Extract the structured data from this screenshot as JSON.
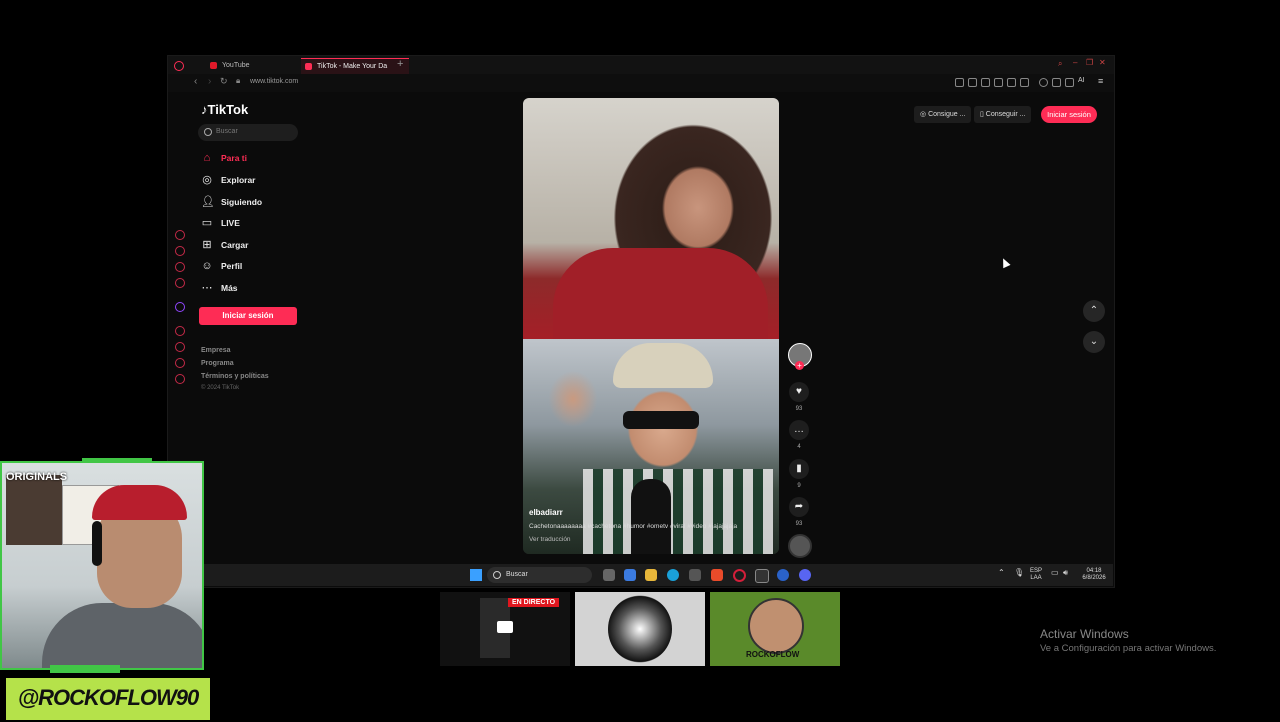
{
  "browser": {
    "tabs": [
      {
        "label": "YouTube"
      },
      {
        "label": "TikTok - Make Your Da"
      }
    ],
    "url": "www.tiktok.com"
  },
  "tiktok": {
    "logo": "TikTok",
    "search_placeholder": "Buscar",
    "nav": [
      {
        "label": "Para ti",
        "icon": "home-icon"
      },
      {
        "label": "Explorar",
        "icon": "compass-icon"
      },
      {
        "label": "Siguiendo",
        "icon": "following-icon"
      },
      {
        "label": "LIVE",
        "icon": "live-icon"
      },
      {
        "label": "Cargar",
        "icon": "upload-icon"
      },
      {
        "label": "Perfil",
        "icon": "profile-icon"
      },
      {
        "label": "Más",
        "icon": "more-icon"
      }
    ],
    "login_side": "Iniciar sesión",
    "footer": [
      "Empresa",
      "Programa",
      "Términos y políticas",
      "© 2024 TikTok"
    ],
    "top_buttons": [
      "Consigue ...",
      "Conseguir ...",
      "Iniciar sesión"
    ],
    "video": {
      "username": "elbadiarr",
      "caption": "Cachetonaaaaaaaa #cachetona #humor #ometv #viral #video #jajajajaja",
      "translate": "Ver traducción"
    },
    "actions": {
      "likes": "93",
      "comments": "4",
      "saves": "9",
      "shares": "93"
    }
  },
  "taskbar": {
    "search_label": "Buscar",
    "lang_top": "ESP",
    "lang_bottom": "LAA",
    "time": "04:18",
    "date": "6/8/2026"
  },
  "overlay": {
    "webcam_text": "ORIGINALS",
    "handle": "@ROCKOFLOW90",
    "live_badge": "EN DIRECTO",
    "avatar_brand": "ROCKOFLOW"
  },
  "windows_watermark": {
    "line1": "Activar Windows",
    "line2": "Ve a Configuración para activar Windows."
  },
  "colors": {
    "accent": "#fe2c55",
    "overlay_green": "#41c646",
    "handle_bg": "#b5e24a"
  }
}
